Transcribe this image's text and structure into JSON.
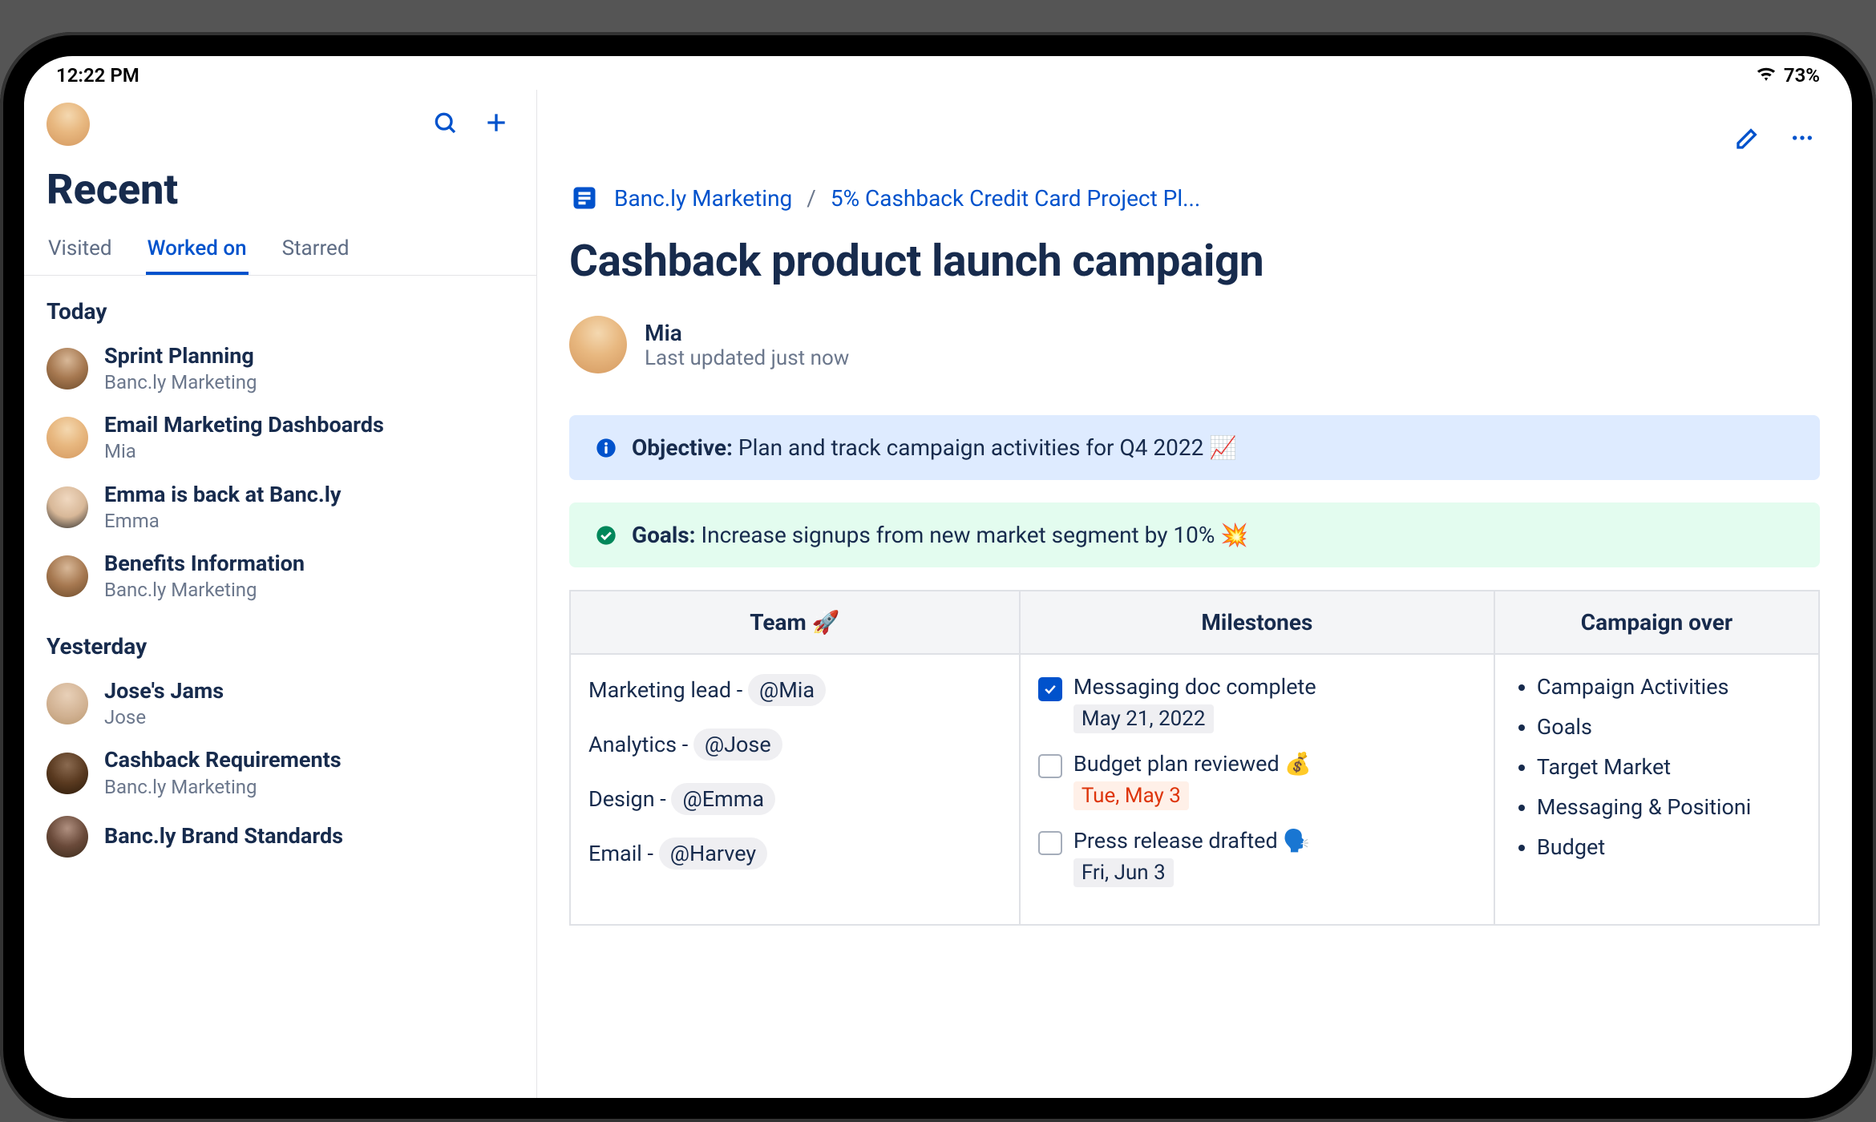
{
  "statusbar": {
    "time": "12:22 PM",
    "battery": "73%"
  },
  "sidebar": {
    "title": "Recent",
    "tabs": {
      "visited": "Visited",
      "worked_on": "Worked on",
      "starred": "Starred"
    },
    "sections": [
      {
        "label": "Today",
        "items": [
          {
            "title": "Sprint Planning",
            "sub": "Banc.ly Marketing"
          },
          {
            "title": "Email Marketing Dashboards",
            "sub": "Mia"
          },
          {
            "title": "Emma is back at Banc.ly",
            "sub": "Emma"
          },
          {
            "title": "Benefits Information",
            "sub": "Banc.ly Marketing"
          }
        ]
      },
      {
        "label": "Yesterday",
        "items": [
          {
            "title": "Jose's Jams",
            "sub": "Jose"
          },
          {
            "title": "Cashback Requirements",
            "sub": "Banc.ly Marketing"
          },
          {
            "title": "Banc.ly Brand Standards",
            "sub": ""
          }
        ]
      }
    ]
  },
  "breadcrumb": {
    "space": "Banc.ly Marketing",
    "sep": "/",
    "parent": "5% Cashback Credit Card Project Pl..."
  },
  "page": {
    "title": "Cashback product launch campaign",
    "author": "Mia",
    "updated": "Last updated just now"
  },
  "panels": {
    "objective_label": "Objective:",
    "objective_text": " Plan and track campaign activities for Q4 2022  📈",
    "goals_label": "Goals:",
    "goals_text": " Increase signups from new market segment by 10% 💥"
  },
  "table": {
    "headers": {
      "team": "Team 🚀",
      "milestones": "Milestones",
      "overview": "Campaign over"
    },
    "team": [
      {
        "role": "Marketing lead - ",
        "mention": "@Mia"
      },
      {
        "role": "Analytics - ",
        "mention": "@Jose"
      },
      {
        "role": "Design - ",
        "mention": "@Emma"
      },
      {
        "role": "Email - ",
        "mention": "@Harvey"
      }
    ],
    "milestones": [
      {
        "checked": true,
        "label": "Messaging doc complete",
        "date": "May 21, 2022",
        "overdue": false
      },
      {
        "checked": false,
        "label": "Budget plan reviewed 💰",
        "date": "Tue, May 3",
        "overdue": true
      },
      {
        "checked": false,
        "label": "Press release drafted 🗣️",
        "date": "Fri, Jun 3",
        "overdue": false
      }
    ],
    "overview": [
      "Campaign Activities",
      "Goals",
      "Target Market",
      "Messaging & Positioni",
      "Budget"
    ]
  }
}
